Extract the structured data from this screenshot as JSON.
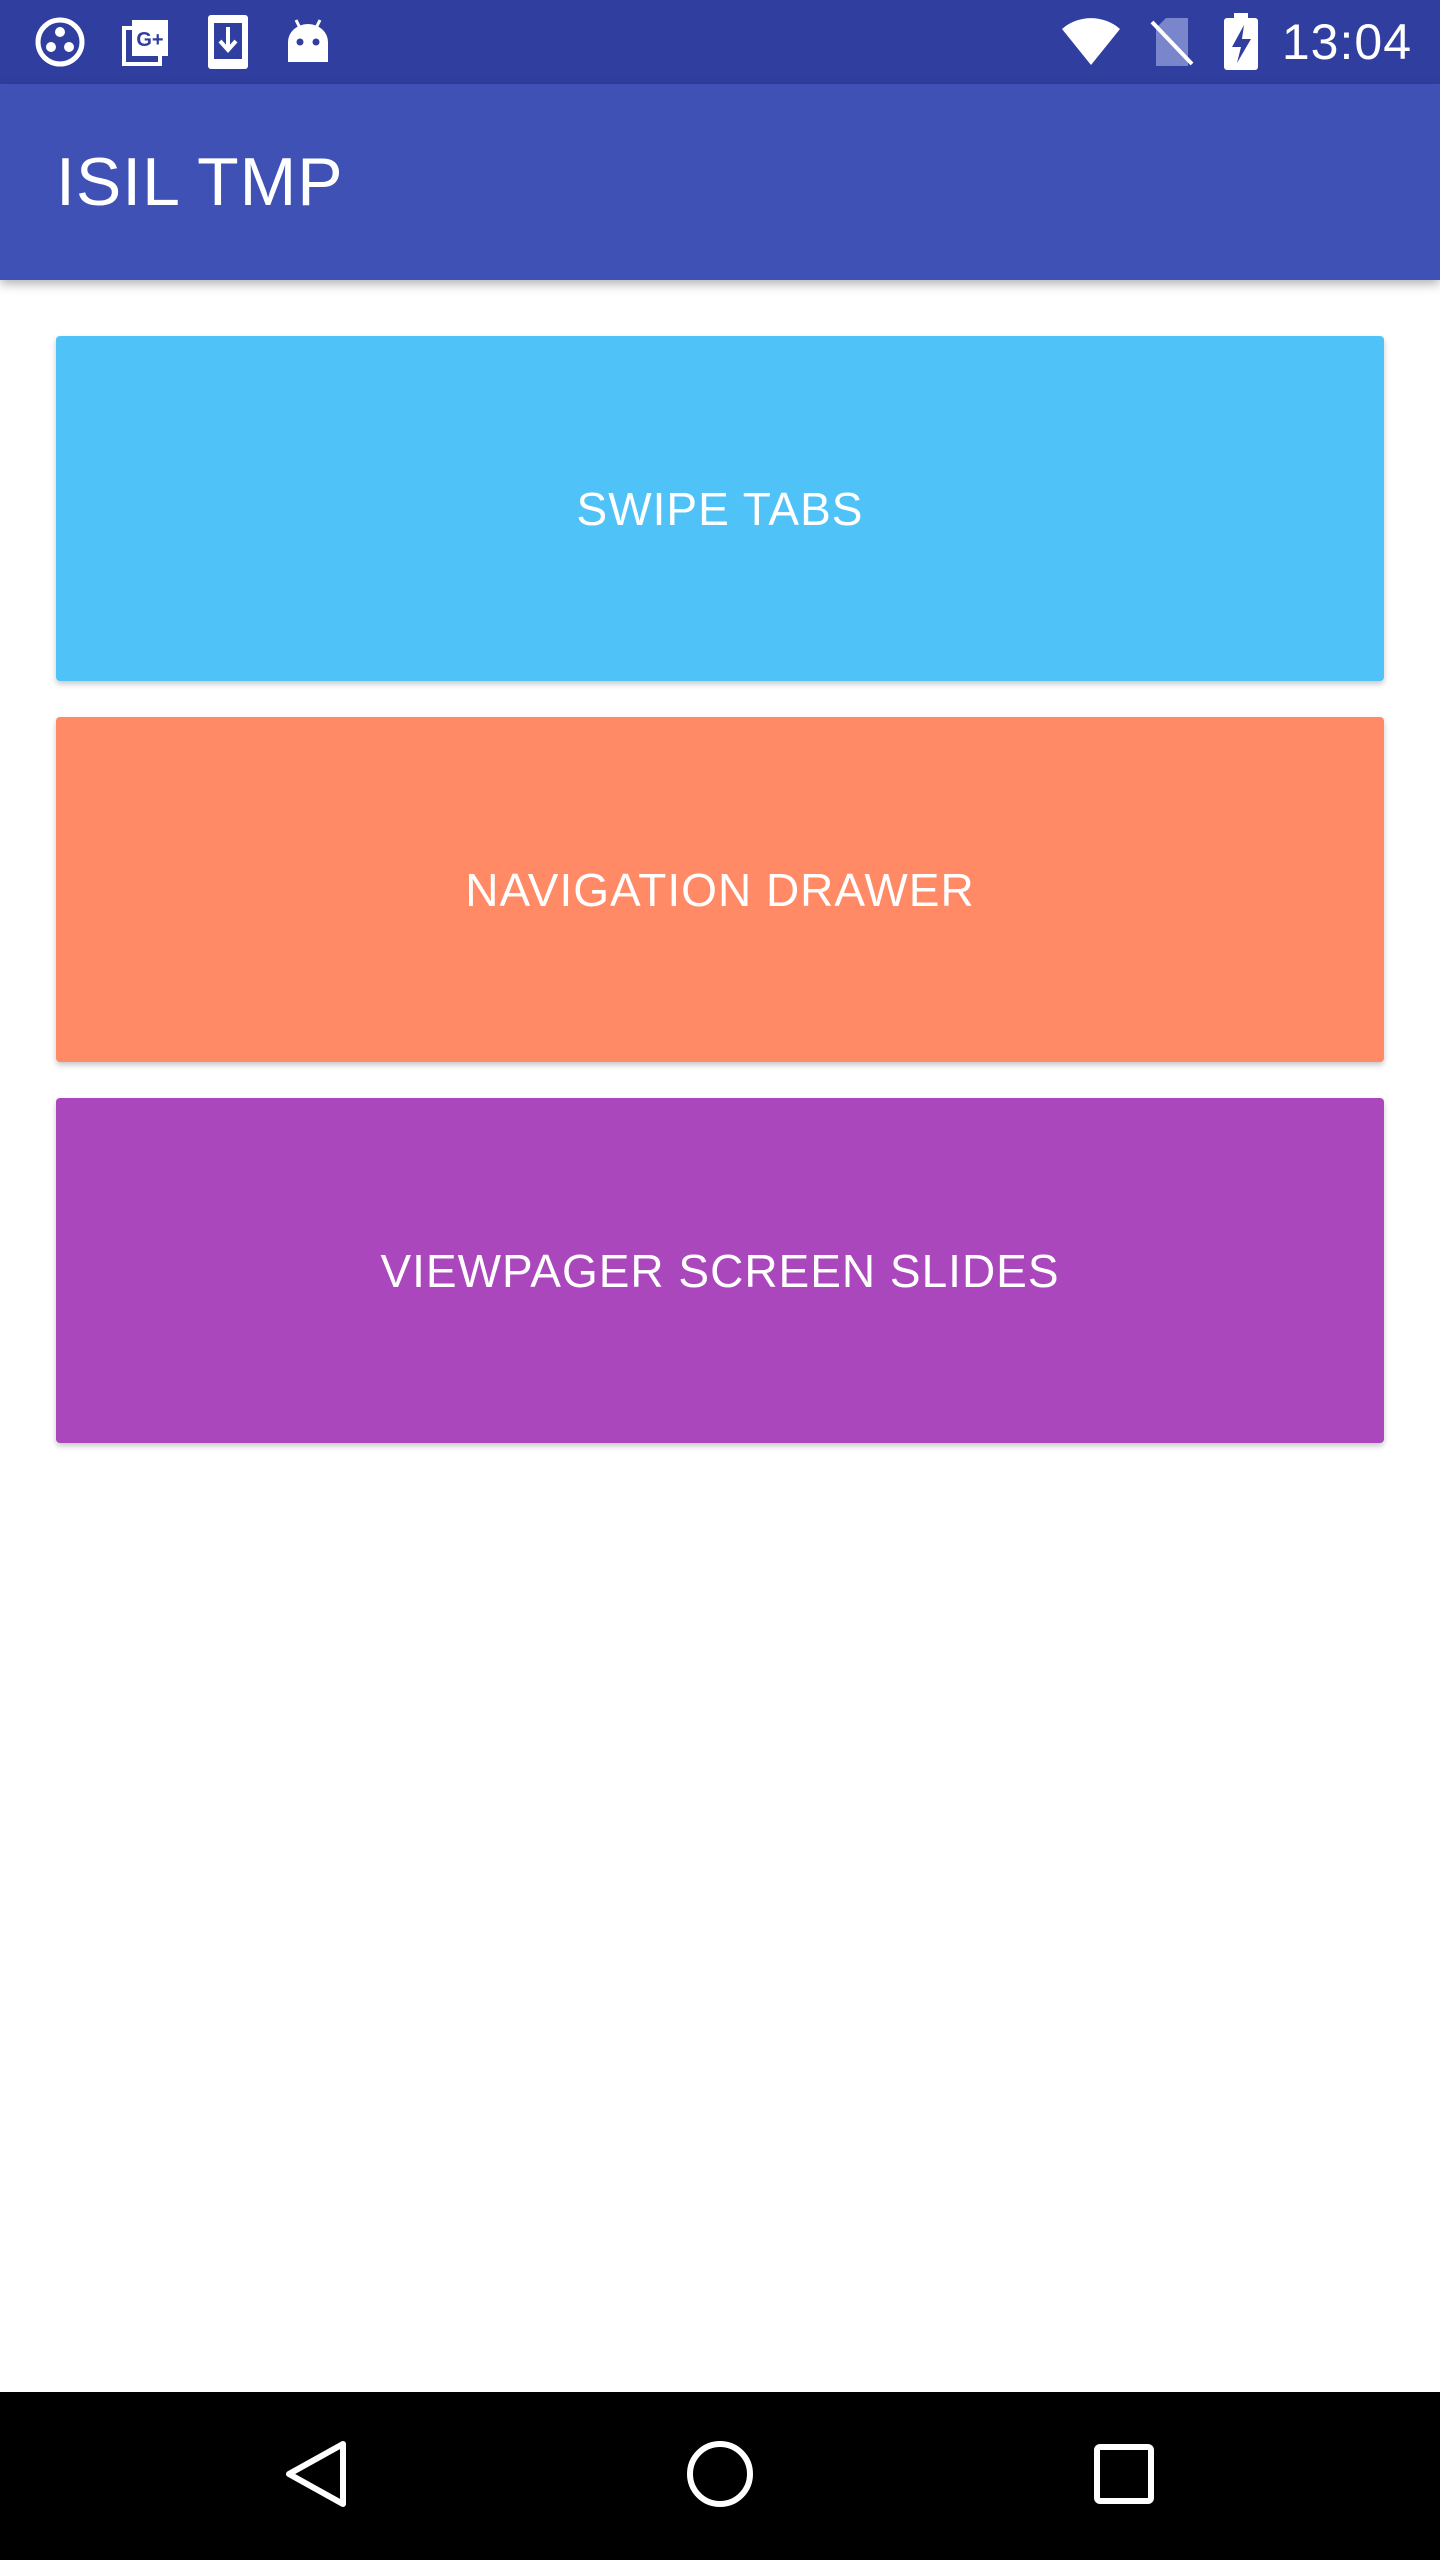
{
  "status_bar": {
    "time": "13:04",
    "background": "#303f9f",
    "left_icons": [
      "community-icon",
      "google-plus-photos-icon",
      "download-icon",
      "android-icon"
    ],
    "right_icons": [
      "wifi-icon",
      "no-sim-icon",
      "battery-charging-icon"
    ]
  },
  "app_bar": {
    "title": "ISIL TMP",
    "background": "#3f51b5"
  },
  "buttons": [
    {
      "label": "SWIPE TABS",
      "color": "#4fc3f7"
    },
    {
      "label": "NAVIGATION DRAWER",
      "color": "#ff8a65"
    },
    {
      "label": "VIEWPAGER SCREEN SLIDES",
      "color": "#ab47bc"
    }
  ],
  "nav_bar": {
    "background": "#000000",
    "icons": [
      "back-icon",
      "home-icon",
      "recents-icon"
    ]
  }
}
